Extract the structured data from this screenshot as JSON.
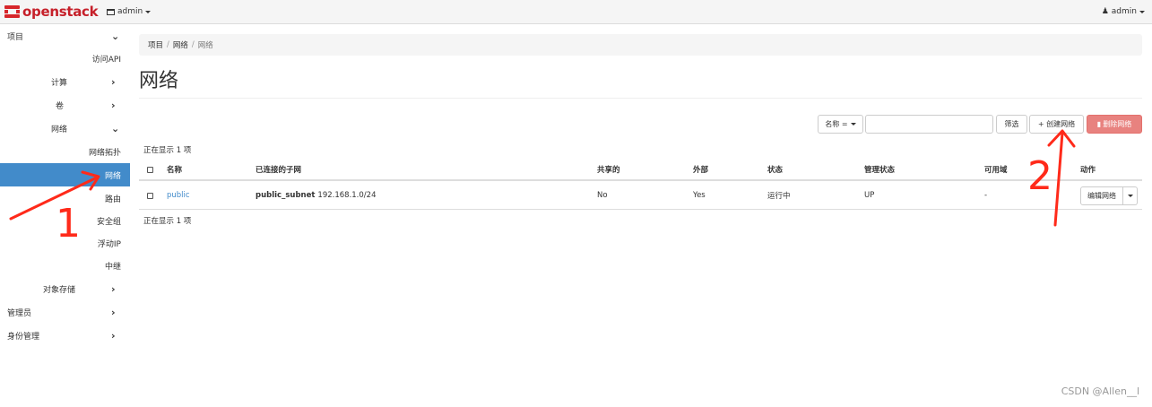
{
  "topbar": {
    "brand": "openstack",
    "project_selector": "admin",
    "user_menu": "admin"
  },
  "sidebar": {
    "items": [
      {
        "label": "项目",
        "indicator": "chevron-down"
      },
      {
        "label": "访问API"
      },
      {
        "label": "计算",
        "indicator": "chevron-right"
      },
      {
        "label": "卷",
        "indicator": "chevron-right"
      },
      {
        "label": "网络",
        "indicator": "chevron-down"
      },
      {
        "label": "网络拓扑"
      },
      {
        "label": "网络",
        "active": true
      },
      {
        "label": "路由"
      },
      {
        "label": "安全组"
      },
      {
        "label": "浮动IP"
      },
      {
        "label": "中继"
      },
      {
        "label": "对象存储",
        "indicator": "chevron-right"
      },
      {
        "label": "管理员",
        "indicator": "chevron-right"
      },
      {
        "label": "身份管理",
        "indicator": "chevron-right"
      }
    ]
  },
  "breadcrumb": [
    "项目",
    "网络",
    "网络"
  ],
  "page": {
    "title": "网络",
    "filter_dropdown": "名称 =",
    "filter_input_value": "",
    "filter_button": "筛选",
    "create_button": "+ 创建网络",
    "delete_button": "删除网络",
    "count_text": "正在显示 1 项"
  },
  "table": {
    "columns": [
      "名称",
      "已连接的子网",
      "共享的",
      "外部",
      "状态",
      "管理状态",
      "可用域",
      "动作"
    ],
    "rows": [
      {
        "name": "public",
        "subnet_name": "public_subnet",
        "subnet_cidr": "192.168.1.0/24",
        "shared": "No",
        "external": "Yes",
        "status": "运行中",
        "admin_state": "UP",
        "availability_zone": "-",
        "action": "编辑网络"
      }
    ]
  },
  "annotations": {
    "label_1": "1",
    "label_2": "2",
    "color": "#ff2a1a"
  },
  "watermark": "CSDN @Allen__l"
}
